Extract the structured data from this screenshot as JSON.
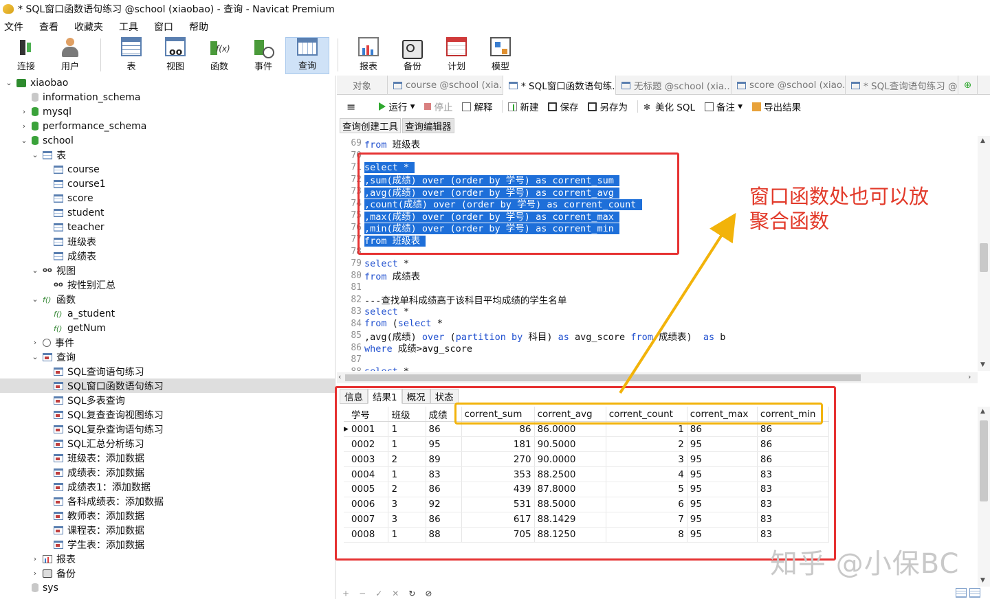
{
  "window": {
    "title": "* SQL窗口函数语句练习 @school (xiaobao) - 查询 - Navicat Premium"
  },
  "menu": [
    "文件",
    "查看",
    "收藏夹",
    "工具",
    "窗口",
    "帮助"
  ],
  "toolbar": {
    "group1": [
      {
        "label": "连接",
        "icon": "connection-icon"
      },
      {
        "label": "用户",
        "icon": "user-icon"
      }
    ],
    "group2": [
      {
        "label": "表",
        "icon": "table-icon"
      },
      {
        "label": "视图",
        "icon": "view-icon"
      },
      {
        "label": "函数",
        "icon": "function-icon"
      },
      {
        "label": "事件",
        "icon": "event-icon"
      },
      {
        "label": "查询",
        "icon": "query-icon"
      }
    ],
    "group3": [
      {
        "label": "报表",
        "icon": "report-icon"
      },
      {
        "label": "备份",
        "icon": "backup-icon"
      },
      {
        "label": "计划",
        "icon": "schedule-icon"
      },
      {
        "label": "模型",
        "icon": "model-icon"
      }
    ]
  },
  "tree": [
    {
      "label": "xiaobao",
      "depth": 0,
      "toggle": "⌄",
      "icon": "conn"
    },
    {
      "label": "information_schema",
      "depth": 1,
      "toggle": "",
      "icon": "dbg"
    },
    {
      "label": "mysql",
      "depth": 1,
      "toggle": "›",
      "icon": "db"
    },
    {
      "label": "performance_schema",
      "depth": 1,
      "toggle": "›",
      "icon": "db"
    },
    {
      "label": "school",
      "depth": 1,
      "toggle": "⌄",
      "icon": "db"
    },
    {
      "label": "表",
      "depth": 2,
      "toggle": "⌄",
      "icon": "tbl"
    },
    {
      "label": "course",
      "depth": 3,
      "toggle": "",
      "icon": "tbl"
    },
    {
      "label": "course1",
      "depth": 3,
      "toggle": "",
      "icon": "tbl"
    },
    {
      "label": "score",
      "depth": 3,
      "toggle": "",
      "icon": "tbl"
    },
    {
      "label": "student",
      "depth": 3,
      "toggle": "",
      "icon": "tbl"
    },
    {
      "label": "teacher",
      "depth": 3,
      "toggle": "",
      "icon": "tbl"
    },
    {
      "label": "班级表",
      "depth": 3,
      "toggle": "",
      "icon": "tbl"
    },
    {
      "label": "成绩表",
      "depth": 3,
      "toggle": "",
      "icon": "tbl"
    },
    {
      "label": "视图",
      "depth": 2,
      "toggle": "⌄",
      "icon": "view"
    },
    {
      "label": "按性别汇总",
      "depth": 3,
      "toggle": "",
      "icon": "view"
    },
    {
      "label": "函数",
      "depth": 2,
      "toggle": "⌄",
      "icon": "func"
    },
    {
      "label": "a_student",
      "depth": 3,
      "toggle": "",
      "icon": "func"
    },
    {
      "label": "getNum",
      "depth": 3,
      "toggle": "",
      "icon": "func"
    },
    {
      "label": "事件",
      "depth": 2,
      "toggle": "›",
      "icon": "evt"
    },
    {
      "label": "查询",
      "depth": 2,
      "toggle": "⌄",
      "icon": "qry"
    },
    {
      "label": "SQL查询语句练习",
      "depth": 3,
      "toggle": "",
      "icon": "qry"
    },
    {
      "label": "SQL窗口函数语句练习",
      "depth": 3,
      "toggle": "",
      "icon": "qry",
      "selected": true
    },
    {
      "label": "SQL多表查询",
      "depth": 3,
      "toggle": "",
      "icon": "qry"
    },
    {
      "label": "SQL复查查询视图练习",
      "depth": 3,
      "toggle": "",
      "icon": "qry"
    },
    {
      "label": "SQL复杂查询语句练习",
      "depth": 3,
      "toggle": "",
      "icon": "qry"
    },
    {
      "label": "SQL汇总分析练习",
      "depth": 3,
      "toggle": "",
      "icon": "qry"
    },
    {
      "label": "班级表：添加数据",
      "depth": 3,
      "toggle": "",
      "icon": "qry"
    },
    {
      "label": "成绩表：添加数据",
      "depth": 3,
      "toggle": "",
      "icon": "qry"
    },
    {
      "label": "成绩表1：添加数据",
      "depth": 3,
      "toggle": "",
      "icon": "qry"
    },
    {
      "label": "各科成绩表：添加数据",
      "depth": 3,
      "toggle": "",
      "icon": "qry"
    },
    {
      "label": "教师表：添加数据",
      "depth": 3,
      "toggle": "",
      "icon": "qry"
    },
    {
      "label": "课程表：添加数据",
      "depth": 3,
      "toggle": "",
      "icon": "qry"
    },
    {
      "label": "学生表：添加数据",
      "depth": 3,
      "toggle": "",
      "icon": "qry"
    },
    {
      "label": "报表",
      "depth": 2,
      "toggle": "›",
      "icon": "rep"
    },
    {
      "label": "备份",
      "depth": 2,
      "toggle": "›",
      "icon": "bak"
    },
    {
      "label": "sys",
      "depth": 1,
      "toggle": "",
      "icon": "dbg"
    }
  ],
  "tabs": [
    {
      "label": "对象",
      "active": false,
      "icon": false
    },
    {
      "label": "course @school (xia...",
      "active": false,
      "icon": true
    },
    {
      "label": "* SQL窗口函数语句练...",
      "active": true,
      "icon": true
    },
    {
      "label": "无标题 @school (xia...",
      "active": false,
      "icon": true
    },
    {
      "label": "score @school (xiao...",
      "active": false,
      "icon": true
    },
    {
      "label": "* SQL查询语句练习 @...",
      "active": false,
      "icon": true
    }
  ],
  "editor_toolbar": {
    "menu": "≡",
    "run": "运行",
    "stop": "停止",
    "explain": "解释",
    "new": "新建",
    "save": "保存",
    "save_as": "另存为",
    "beautify": "美化 SQL",
    "comment": "备注",
    "export": "导出结果"
  },
  "subtabs": [
    "查询创建工具",
    "查询编辑器"
  ],
  "code": [
    {
      "no": "69",
      "text": "from 班级表",
      "sel": false
    },
    {
      "no": "70",
      "text": "",
      "sel": false
    },
    {
      "no": "71",
      "text": "select *",
      "sel": true
    },
    {
      "no": "72",
      "text": ",sum(成绩) over (order by 学号) as corrent_sum",
      "sel": true
    },
    {
      "no": "73",
      "text": ",avg(成绩) over (order by 学号) as corrent_avg",
      "sel": true
    },
    {
      "no": "74",
      "text": ",count(成绩) over (order by 学号) as corrent_count",
      "sel": true
    },
    {
      "no": "75",
      "text": ",max(成绩) over (order by 学号) as corrent_max",
      "sel": true
    },
    {
      "no": "76",
      "text": ",min(成绩) over (order by 学号) as corrent_min",
      "sel": true
    },
    {
      "no": "77",
      "text": "from 班级表",
      "sel": true
    },
    {
      "no": "78",
      "text": "",
      "sel": false
    },
    {
      "no": "79",
      "text": "select *",
      "sel": false
    },
    {
      "no": "80",
      "text": "from 成绩表",
      "sel": false
    },
    {
      "no": "81",
      "text": "",
      "sel": false
    },
    {
      "no": "82",
      "text": "---查找单科成绩高于该科目平均成绩的学生名单",
      "sel": false
    },
    {
      "no": "83",
      "text": "select *",
      "sel": false
    },
    {
      "no": "84",
      "text": "from (select *",
      "sel": false
    },
    {
      "no": "85",
      "text": ",avg(成绩) over (partition by 科目) as avg_score from 成绩表)  as b",
      "sel": false
    },
    {
      "no": "86",
      "text": "where 成绩>avg_score",
      "sel": false
    },
    {
      "no": "87",
      "text": "",
      "sel": false
    },
    {
      "no": "88",
      "text": "select *",
      "sel": false
    }
  ],
  "result_tabs": [
    "信息",
    "结果1",
    "概况",
    "状态"
  ],
  "result": {
    "columns": [
      "学号",
      "班级",
      "成绩",
      "corrent_sum",
      "corrent_avg",
      "corrent_count",
      "corrent_max",
      "corrent_min"
    ],
    "rows": [
      [
        "0001",
        "1",
        "86",
        "86",
        "86.0000",
        "1",
        "86",
        "86"
      ],
      [
        "0002",
        "1",
        "95",
        "181",
        "90.5000",
        "2",
        "95",
        "86"
      ],
      [
        "0003",
        "2",
        "89",
        "270",
        "90.0000",
        "3",
        "95",
        "86"
      ],
      [
        "0004",
        "1",
        "83",
        "353",
        "88.2500",
        "4",
        "95",
        "83"
      ],
      [
        "0005",
        "2",
        "86",
        "439",
        "87.8000",
        "5",
        "95",
        "83"
      ],
      [
        "0006",
        "3",
        "92",
        "531",
        "88.5000",
        "6",
        "95",
        "83"
      ],
      [
        "0007",
        "3",
        "86",
        "617",
        "88.1429",
        "7",
        "95",
        "83"
      ],
      [
        "0008",
        "1",
        "88",
        "705",
        "88.1250",
        "8",
        "95",
        "83"
      ]
    ]
  },
  "annotation": {
    "line1": "窗口函数处也可以放",
    "line2": "聚合函数"
  },
  "watermark": "知乎 @小保BC",
  "status_icons": [
    "+",
    "−",
    "✓",
    "✕",
    "↻",
    "⊘"
  ],
  "colors": {
    "highlight": "#1e6fd9",
    "red_box": "#e63232",
    "yellow_box": "#f2b30a",
    "annotation": "#e23a2a"
  }
}
